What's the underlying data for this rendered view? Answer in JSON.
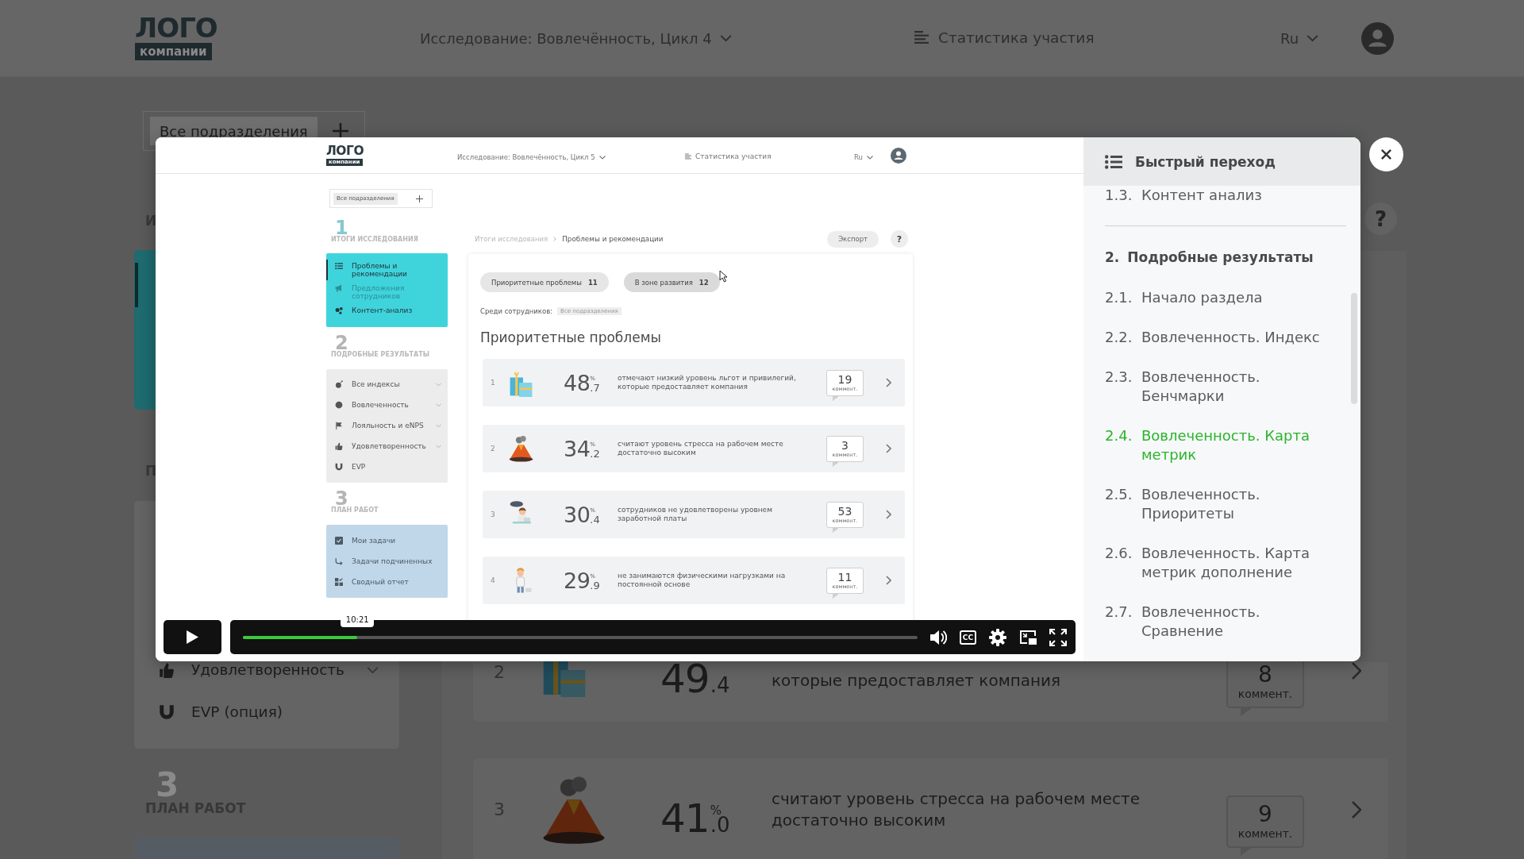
{
  "header": {
    "logo_word": "ЛОГО",
    "logo_caption": "компании",
    "survey": "Исследование: Вовлечённость, Цикл 4",
    "stats": "Статистика участия",
    "language": "Ru"
  },
  "filter": {
    "chip": "Все подразделения"
  },
  "sidebar": {
    "sections": [
      {
        "heading": "И",
        "color": "#1e6b70",
        "active": true
      },
      {
        "heading": "П",
        "color": "#646464",
        "active": false,
        "items": [
          {
            "label": "Удовлетворенность",
            "expandable": true
          },
          {
            "label": "EVP (опция)",
            "expandable": false
          }
        ]
      },
      {
        "number": "3",
        "heading": "ПЛАН РАБОТ",
        "color": "#555c63",
        "active": false
      }
    ]
  },
  "help": "?",
  "problems": [
    {
      "index": "2",
      "value": "49",
      "decimal": ".4",
      "text": "которые предоставляет компания",
      "comments": "8",
      "comments_label": "коммент."
    },
    {
      "index": "3",
      "value": "41",
      "decimal": ".0",
      "unit": "%",
      "text": "считают уровень стресса на рабочем месте достаточно высоким",
      "comments": "9",
      "comments_label": "коммент."
    }
  ],
  "video_player": {
    "screen": {
      "header": {
        "logo_word": "ЛОГО",
        "logo_caption": "компании",
        "survey": "Исследование: Вовлечённость, Цикл 5",
        "stats": "Статистика участия",
        "language": "Ru"
      },
      "filter": {
        "chip": "Все подразделения"
      },
      "sidebar": [
        {
          "number": "1",
          "heading": "ИТОГИ ИССЛЕДОВАНИЯ",
          "color": "#3fd4dc",
          "items": [
            {
              "label": "Проблемы и рекомендации",
              "selected": true,
              "disabled": false
            },
            {
              "label": "Предложения сотрудников",
              "selected": false,
              "disabled": true
            },
            {
              "label": "Контент-анализ",
              "selected": false,
              "disabled": false
            }
          ]
        },
        {
          "number": "2",
          "heading": "ПОДРОБНЫЕ РЕЗУЛЬТАТЫ",
          "color": "#ececed",
          "items": [
            {
              "label": "Все индексы",
              "expandable": true
            },
            {
              "label": "Вовлеченность",
              "expandable": true
            },
            {
              "label": "Лояльность и eNPS",
              "expandable": true
            },
            {
              "label": "Удовлетворенность",
              "expandable": true
            },
            {
              "label": "EVP",
              "expandable": false
            }
          ]
        },
        {
          "number": "3",
          "heading": "ПЛАН РАБОТ",
          "color": "#c0d7ea",
          "items": [
            {
              "label": "Мои задачи"
            },
            {
              "label": "Задачи подчиненных"
            },
            {
              "label": "Сводный отчет"
            }
          ]
        }
      ],
      "breadcrumb": [
        "Итоги исследования",
        "Проблемы и рекомендации"
      ],
      "export": "Экспорт",
      "help": "?",
      "tabs": [
        {
          "label": "Приоритетные проблемы",
          "count": "11",
          "selected": true
        },
        {
          "label": "В зоне развития",
          "count": "12",
          "selected": false
        }
      ],
      "audience": {
        "label": "Среди сотрудников:",
        "chip": "Все подразделения"
      },
      "heading": "Приоритетные проблемы",
      "problems": [
        {
          "index": "1",
          "value": "48",
          "decimal": ".7",
          "unit": "%",
          "text": "отмечают низкий уровень льгот и привилегий, которые предоставляет компания",
          "comments": "19",
          "comments_label": "коммент."
        },
        {
          "index": "2",
          "value": "34",
          "decimal": ".2",
          "unit": "%",
          "text": "считают уровень стресса на рабочем месте достаточно высоким",
          "comments": "3",
          "comments_label": "коммент."
        },
        {
          "index": "3",
          "value": "30",
          "decimal": ".4",
          "unit": "%",
          "text": "сотрудников не удовлетворены уровнем заработной платы",
          "comments": "53",
          "comments_label": "коммент."
        },
        {
          "index": "4",
          "value": "29",
          "decimal": ".9",
          "unit": "%",
          "text": "не занимаются физическими нагрузками на постоянной основе",
          "comments": "11",
          "comments_label": "коммент."
        }
      ]
    },
    "controls": {
      "time": "10:21",
      "level": 0.17,
      "captions": "CC"
    }
  },
  "quick_nav": {
    "title": "Быстрый переход",
    "groups": [
      {
        "items": [
          {
            "number": "1.3.",
            "label": "Контент анализ",
            "selected": false
          }
        ]
      },
      {
        "number": "2.",
        "title": "Подробные результаты",
        "items": [
          {
            "number": "2.1.",
            "label": "Начало раздела",
            "selected": false
          },
          {
            "number": "2.2.",
            "label": "Вовлеченность. Индекс",
            "selected": false
          },
          {
            "number": "2.3.",
            "label": "Вовлеченность. Бенчмарки",
            "selected": false
          },
          {
            "number": "2.4.",
            "label": "Вовлеченность. Карта метрик",
            "selected": true
          },
          {
            "number": "2.5.",
            "label": "Вовлеченность. Приоритеты",
            "selected": false
          },
          {
            "number": "2.6.",
            "label": "Вовлеченность. Карта метрик дополнение",
            "selected": false
          },
          {
            "number": "2.7.",
            "label": "Вовлеченность. Сравнение",
            "selected": false
          }
        ]
      }
    ]
  }
}
